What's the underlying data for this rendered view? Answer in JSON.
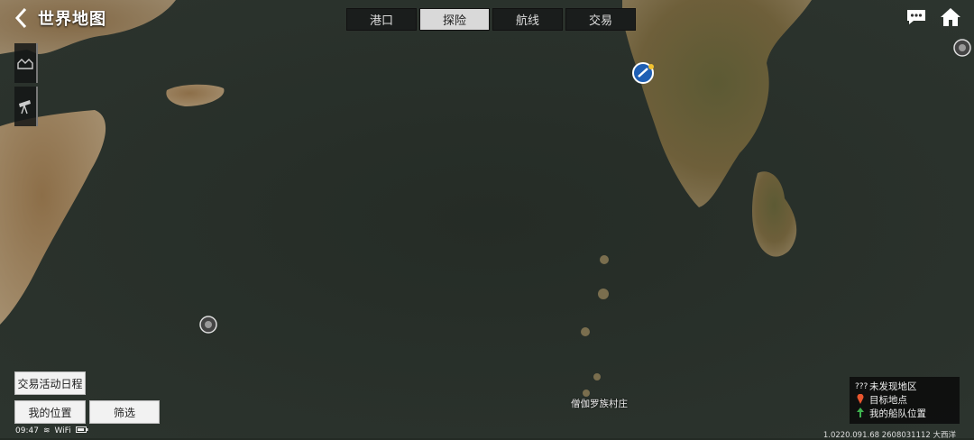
{
  "header": {
    "title": "世界地图",
    "tabs": [
      {
        "label": "港口",
        "active": false
      },
      {
        "label": "探险",
        "active": true
      },
      {
        "label": "航线",
        "active": false
      },
      {
        "label": "交易",
        "active": false
      }
    ]
  },
  "top_right_icons": [
    "chat-icon",
    "home-icon"
  ],
  "side_tools": [
    "town-icon",
    "telescope-icon"
  ],
  "buttons": {
    "schedule": "交易活动日程",
    "my_position": "我的位置",
    "filter": "筛选"
  },
  "map": {
    "place_label": "僧伽罗族村庄"
  },
  "legend": {
    "items": [
      {
        "mark": "???",
        "label": "未发现地区"
      },
      {
        "mark": "pin-icon",
        "label": "目标地点",
        "color": "#e8562e"
      },
      {
        "mark": "fleet-icon",
        "label": "我的船队位置",
        "color": "#3fb34f"
      }
    ]
  },
  "status_bar": {
    "time": "09:47",
    "network": "WiFi"
  },
  "footer": {
    "version": "1.0220.091.68 2608031112 大西洋"
  },
  "colors": {
    "sea": "#232a24",
    "land": "#6b5a3a",
    "tab_active": "#d9d9d9",
    "ship_marker": "#1f5fb4"
  }
}
